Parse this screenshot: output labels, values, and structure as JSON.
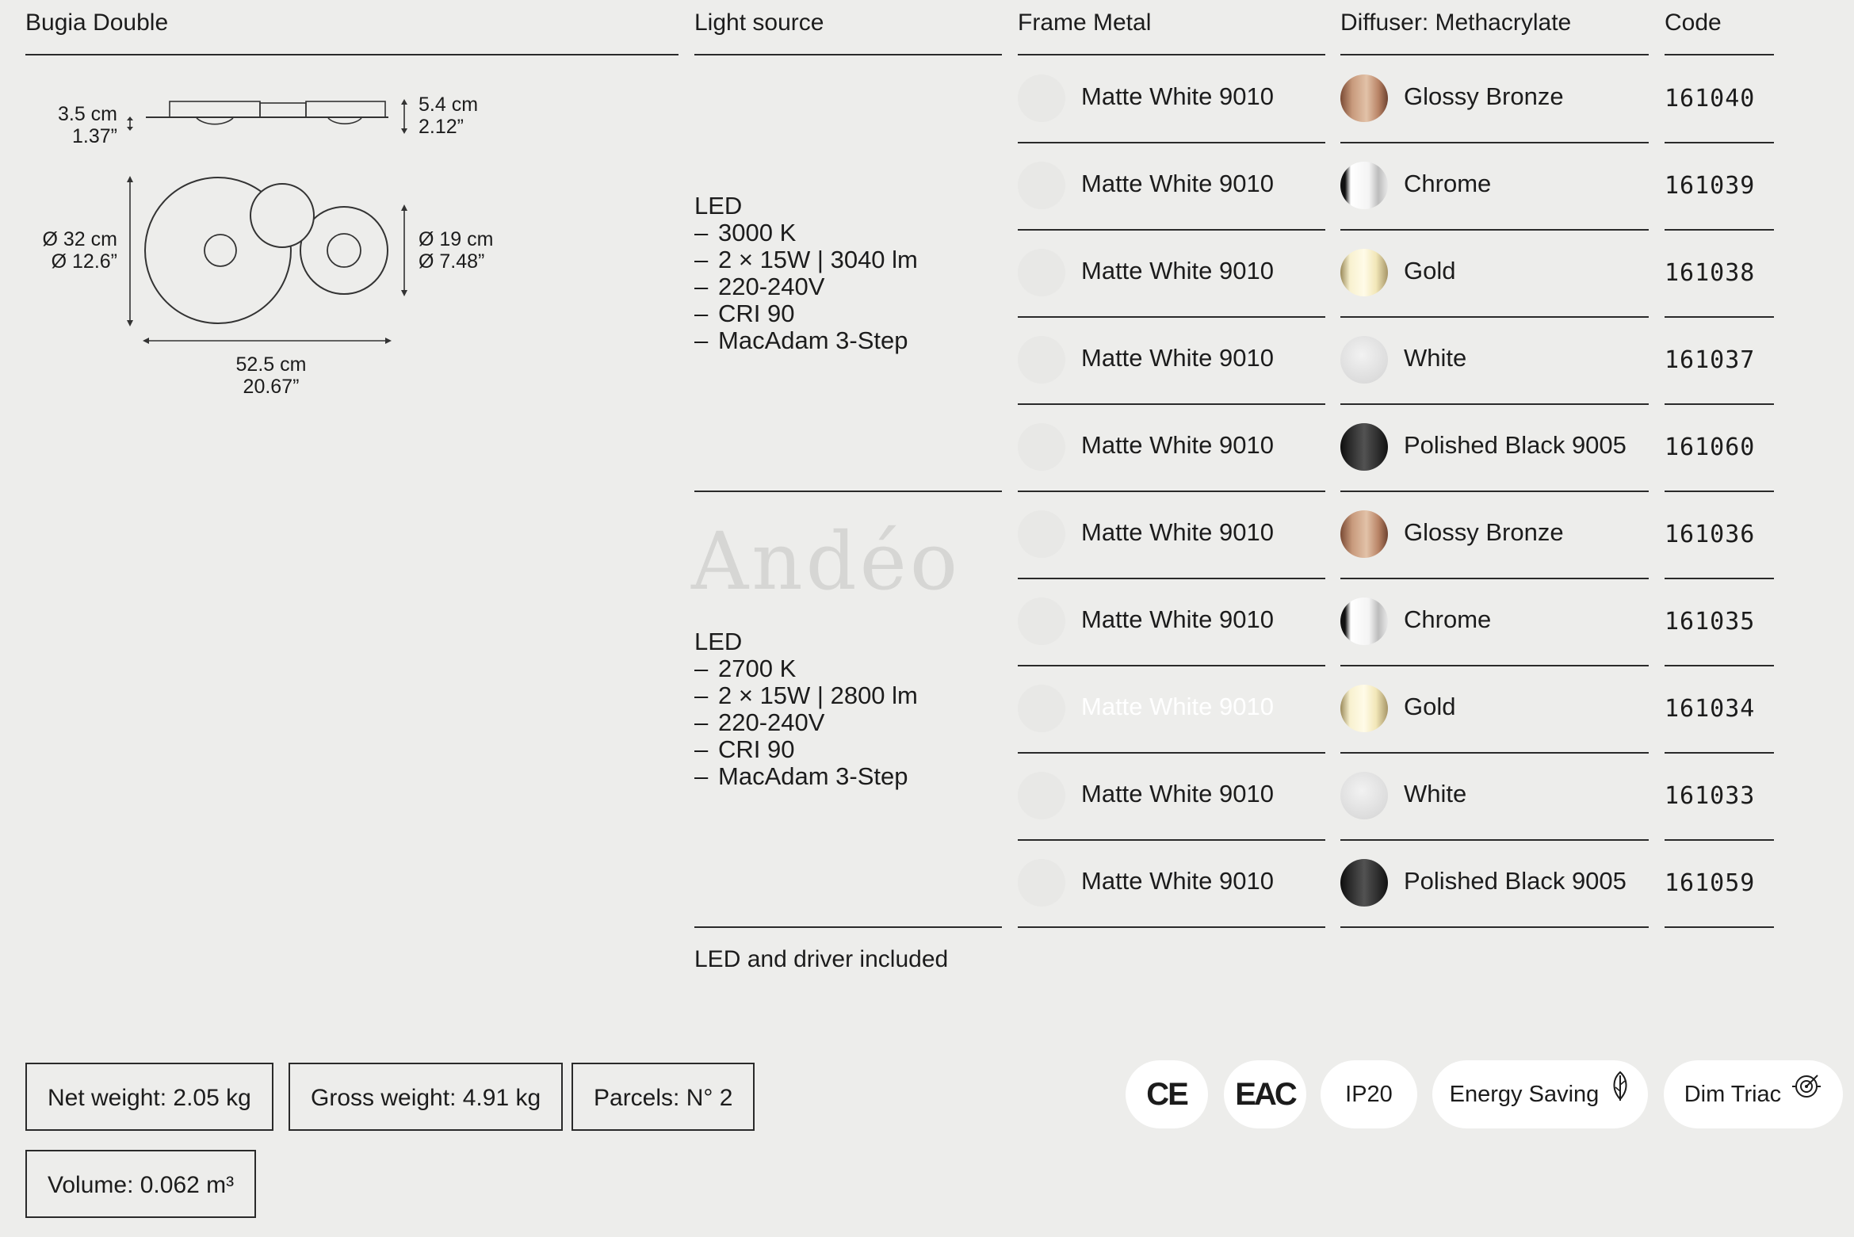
{
  "product": {
    "name": "Bugia Double"
  },
  "headers": {
    "light_source": "Light source",
    "frame": "Frame Metal",
    "diffuser": "Diffuser: Methacrylate",
    "code": "Code"
  },
  "drawing": {
    "height_small": "3.5 cm",
    "height_small_in": "1.37”",
    "height_large": "5.4 cm",
    "height_large_in": "2.12”",
    "diam_large": "Ø 32 cm",
    "diam_large_in": "Ø 12.6”",
    "diam_small": "Ø 19 cm",
    "diam_small_in": "Ø 7.48”",
    "width": "52.5 cm",
    "width_in": "20.67”"
  },
  "light_groups": [
    {
      "title": "LED",
      "items": [
        "3000 K",
        "2 × 15W | 3040 lm",
        "220-240V",
        "CRI 90",
        "MacAdam 3-Step"
      ]
    },
    {
      "title": "LED",
      "items": [
        "2700 K",
        "2 × 15W | 2800 lm",
        "220-240V",
        "CRI 90",
        "MacAdam 3-Step"
      ]
    }
  ],
  "dash": "–",
  "watermark": "Andéo",
  "rows": [
    {
      "frame": "Matte White 9010",
      "diffuser": "Glossy Bronze",
      "code": "161040",
      "finish": "bronze"
    },
    {
      "frame": "Matte White 9010",
      "diffuser": "Chrome",
      "code": "161039",
      "finish": "chrome"
    },
    {
      "frame": "Matte White 9010",
      "diffuser": "Gold",
      "code": "161038",
      "finish": "gold"
    },
    {
      "frame": "Matte White 9010",
      "diffuser": "White",
      "code": "161037",
      "finish": "white"
    },
    {
      "frame": "Matte White 9010",
      "diffuser": "Polished Black 9005",
      "code": "161060",
      "finish": "black"
    },
    {
      "frame": "Matte White 9010",
      "diffuser": "Glossy Bronze",
      "code": "161036",
      "finish": "bronze"
    },
    {
      "frame": "Matte White 9010",
      "diffuser": "Chrome",
      "code": "161035",
      "finish": "chrome"
    },
    {
      "frame": "Matte White 9010",
      "diffuser": "Gold",
      "code": "161034",
      "finish": "gold"
    },
    {
      "frame": "Matte White 9010",
      "diffuser": "White",
      "code": "161033",
      "finish": "white"
    },
    {
      "frame": "Matte White 9010",
      "diffuser": "Polished Black 9005",
      "code": "161059",
      "finish": "black"
    }
  ],
  "note": "LED and driver included",
  "specs": {
    "net_weight": "Net weight: 2.05 kg",
    "gross_weight": "Gross weight: 4.91 kg",
    "parcels": "Parcels: N° 2",
    "volume": "Volume: 0.062 m³"
  },
  "certifications": {
    "ce": "CE",
    "eac": "EAC",
    "ip": "IP20",
    "energy": "Energy Saving",
    "dim": "Dim Triac"
  },
  "colors": {
    "background": "#ededeb",
    "text": "#1c1c1c",
    "rule": "#2a2a2a",
    "frame_swatch": "#e8e8e6",
    "bronze": "#c89a7c",
    "chrome": "#f2f2f2",
    "gold": "#f3ebc8",
    "white_swatch": "#dcdcdc",
    "black": "#3a3a3a"
  }
}
